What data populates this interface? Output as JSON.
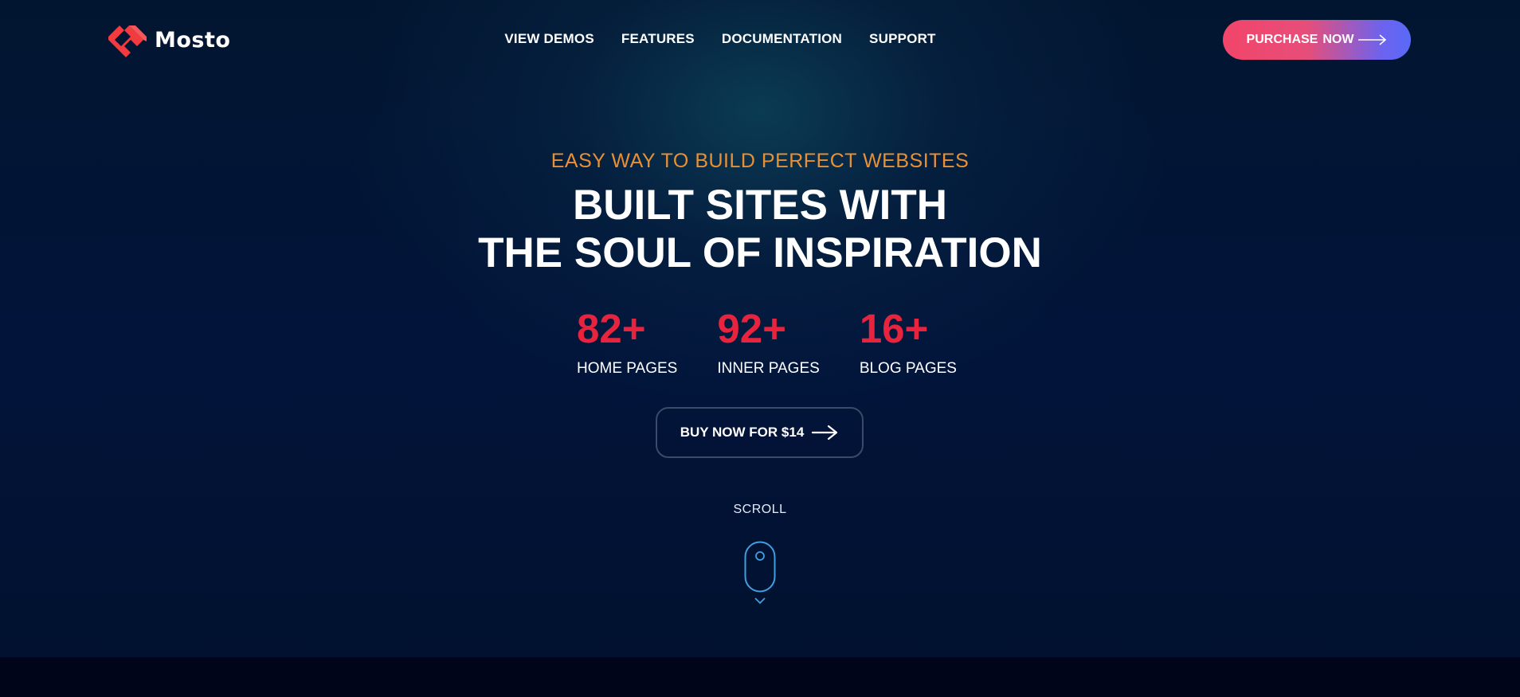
{
  "brand": {
    "name": "Mosto",
    "logo_color": "#f23a3f"
  },
  "nav": {
    "items": [
      {
        "label": "VIEW DEMOS"
      },
      {
        "label": "FEATURES"
      },
      {
        "label": "DOCUMENTATION"
      },
      {
        "label": "SUPPORT"
      }
    ]
  },
  "header": {
    "purchase_label_1": "PURCHASE",
    "purchase_label_2": "NOW",
    "purchase_icon": "arrow-right-icon"
  },
  "hero": {
    "eyebrow": "EASY WAY TO BUILD PERFECT WEBSITES",
    "headline_line1": "BUILT SITES WITH",
    "headline_line2": "THE SOUL OF INSPIRATION",
    "stats": [
      {
        "value": "82+",
        "label": "HOME PAGES"
      },
      {
        "value": "92+",
        "label": "INNER PAGES"
      },
      {
        "value": "16+",
        "label": "BLOG PAGES"
      }
    ],
    "buy_label": "BUY NOW FOR $14",
    "buy_icon": "arrow-right-icon",
    "scroll_label": "SCROLL",
    "scroll_icon": "mouse-icon"
  },
  "colors": {
    "accent_orange": "#e99035",
    "accent_red": "#e8233d",
    "gradient_start": "#f2456a",
    "gradient_end": "#5a6af5",
    "background": "#021530"
  }
}
